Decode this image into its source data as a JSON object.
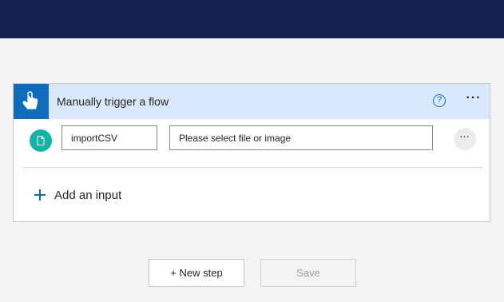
{
  "colors": {
    "topbar": "#18224f",
    "header_bg": "#d9e8fb",
    "accent": "#0f6cbd",
    "file_icon_bg": "#13b3a6"
  },
  "trigger_card": {
    "icon": "hand-touch-icon",
    "title": "Manually trigger a flow",
    "help_icon": "question-circle-icon",
    "help_glyph": "?",
    "more_icon": "more-horizontal-icon",
    "more_glyph": "···",
    "input": {
      "type_icon": "file-icon",
      "name_value": "importCSV",
      "description_placeholder": "Please select file or image",
      "more_glyph": "···"
    },
    "add_input_label": "Add an input"
  },
  "actions": {
    "new_step_label": "+ New step",
    "save_label": "Save"
  }
}
